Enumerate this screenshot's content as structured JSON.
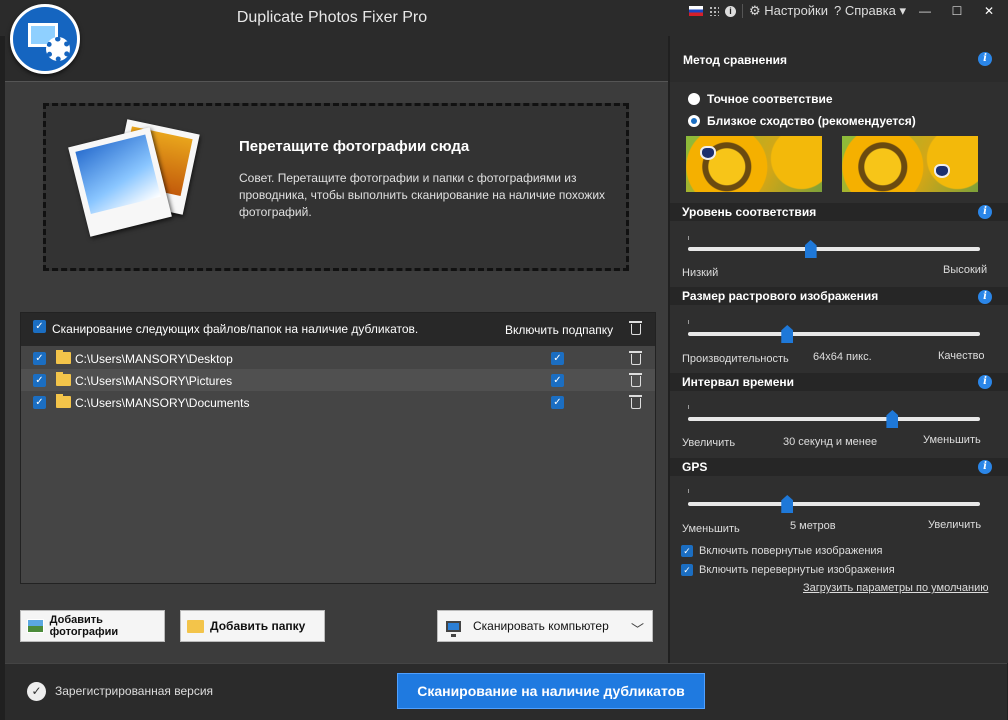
{
  "app": {
    "title": "Duplicate Photos Fixer Pro"
  },
  "titlebar": {
    "settings": "⚙ Настройки",
    "help": "? Справка ▾",
    "minimize": "—",
    "maximize": "☐",
    "close": "✕"
  },
  "dropzone": {
    "title": "Перетащите фотографии сюда",
    "text": "Совет. Перетащите фотографии и папки с фотографиями из проводника, чтобы выполнить сканирование на наличие похожих фотографий."
  },
  "filelist": {
    "header": "Сканирование следующих файлов/папок на наличие дубликатов.",
    "include_sub": "Включить подпапку",
    "rows": [
      {
        "path": "C:\\Users\\MANSORY\\Desktop"
      },
      {
        "path": "C:\\Users\\MANSORY\\Pictures"
      },
      {
        "path": "C:\\Users\\MANSORY\\Documents"
      }
    ]
  },
  "buttons": {
    "add_photos": "Добавить фотографии",
    "add_folder": "Добавить папку",
    "scan_computer": "Сканировать компьютер"
  },
  "bottom": {
    "registered": "Зарегистрированная версия",
    "scan": "Сканирование на наличие дубликатов"
  },
  "side": {
    "method_title": "Метод сравнения",
    "exact": "Точное соответствие",
    "similar": "Близкое сходство (рекомендуется)",
    "selected_method": "similar",
    "match": {
      "title": "Уровень соответствия",
      "low": "Низкий",
      "high": "Высокий",
      "value": 0.42
    },
    "bitmap": {
      "title": "Размер растрового изображения",
      "left": "Производительность",
      "center": "64x64 пикс.",
      "right": "Качество",
      "value": 0.34
    },
    "time": {
      "title": "Интервал времени",
      "left": "Увеличить",
      "center": "30 секунд и менее",
      "right": "Уменьшить",
      "value": 0.7
    },
    "gps": {
      "title": "GPS",
      "left": "Уменьшить",
      "center": "5 метров",
      "right": "Увеличить",
      "value": 0.34
    },
    "rotated": "Включить повернутые изображения",
    "flipped": "Включить перевернутые изображения",
    "defaults": "Загрузить параметры по умолчанию"
  },
  "colors": {
    "accent": "#1e78d8"
  }
}
